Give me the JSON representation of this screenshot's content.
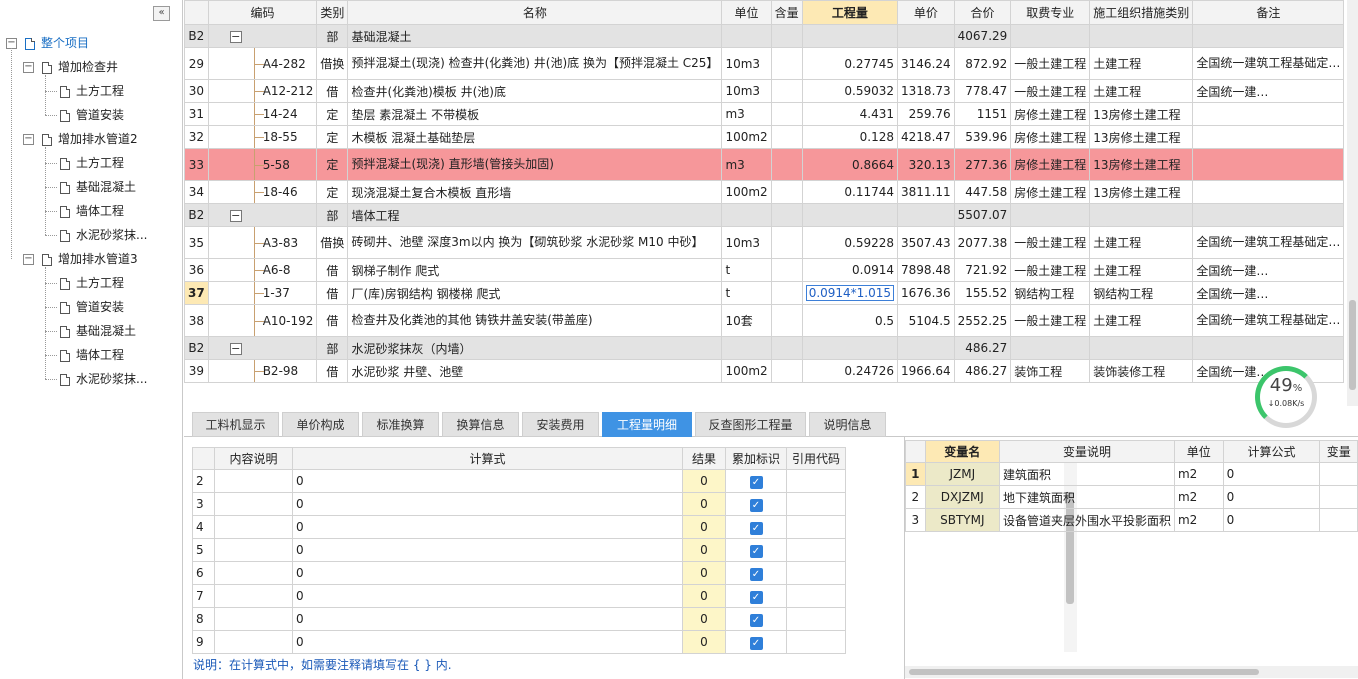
{
  "sidebar": {
    "collapse_icon": "«",
    "root": "整个项目",
    "groups": [
      {
        "label": "增加检查井",
        "children": [
          "土方工程",
          "管道安装"
        ]
      },
      {
        "label": "增加排水管道2",
        "children": [
          "土方工程",
          "基础混凝土",
          "墙体工程",
          "水泥砂浆抹..."
        ]
      },
      {
        "label": "增加排水管道3",
        "children": [
          "土方工程",
          "管道安装",
          "基础混凝土",
          "墙体工程",
          "水泥砂浆抹..."
        ]
      }
    ]
  },
  "grid": {
    "headers": [
      "编码",
      "类别",
      "名称",
      "单位",
      "含量",
      "工程量",
      "单价",
      "合价",
      "取费专业",
      "施工组织措施类别",
      "备注"
    ],
    "rows": [
      {
        "no": "B2",
        "code": "",
        "type": "部",
        "name": "基础混凝土",
        "unit": "",
        "content": "",
        "qty": "",
        "price": "",
        "total": "4067.29",
        "fee": "",
        "measure": "",
        "remark": "",
        "kind": "sec"
      },
      {
        "no": "29",
        "code": "A4-282",
        "type": "借换",
        "name": "预拌混凝土(现浇) 检查井(化粪池) 井(池)底  换为【预拌混凝土 C25】",
        "unit": "10m3",
        "content": "",
        "qty": "0.27745",
        "price": "3146.24",
        "total": "872.92",
        "fee": "一般土建工程",
        "measure": "土建工程",
        "remark": "全国统一建筑工程基础定…",
        "kind": "tall"
      },
      {
        "no": "30",
        "code": "A12-212",
        "type": "借",
        "name": "检查井(化粪池)模板 井(池)底",
        "unit": "10m3",
        "content": "",
        "qty": "0.59032",
        "price": "1318.73",
        "total": "778.47",
        "fee": "一般土建工程",
        "measure": "土建工程",
        "remark": "全国统一建…",
        "kind": ""
      },
      {
        "no": "31",
        "code": "14-24",
        "type": "定",
        "name": "垫层 素混凝土 不带模板",
        "unit": "m3",
        "content": "",
        "qty": "4.431",
        "price": "259.76",
        "total": "1151",
        "fee": "房修土建工程",
        "measure": "13房修土建工程",
        "remark": "",
        "kind": ""
      },
      {
        "no": "32",
        "code": "18-55",
        "type": "定",
        "name": "木模板 混凝土基础垫层",
        "unit": "100m2",
        "content": "",
        "qty": "0.128",
        "price": "4218.47",
        "total": "539.96",
        "fee": "房修土建工程",
        "measure": "13房修土建工程",
        "remark": "",
        "kind": ""
      },
      {
        "no": "33",
        "code": "5-58",
        "type": "定",
        "name": "预拌混凝土(现浇) 直形墙(管接头加固)",
        "unit": "m3",
        "content": "",
        "qty": "0.8664",
        "price": "320.13",
        "total": "277.36",
        "fee": "房修土建工程",
        "measure": "13房修土建工程",
        "remark": "",
        "kind": "hl tall"
      },
      {
        "no": "34",
        "code": "18-46",
        "type": "定",
        "name": "现浇混凝土复合木模板 直形墙",
        "unit": "100m2",
        "content": "",
        "qty": "0.11744",
        "price": "3811.11",
        "total": "447.58",
        "fee": "房修土建工程",
        "measure": "13房修土建工程",
        "remark": "",
        "kind": ""
      },
      {
        "no": "B2",
        "code": "",
        "type": "部",
        "name": "墙体工程",
        "unit": "",
        "content": "",
        "qty": "",
        "price": "",
        "total": "5507.07",
        "fee": "",
        "measure": "",
        "remark": "",
        "kind": "sec"
      },
      {
        "no": "35",
        "code": "A3-83",
        "type": "借换",
        "name": "砖砌井、池壁 深度3m以内  换为【砌筑砂浆 水泥砂浆 M10 中砂】",
        "unit": "10m3",
        "content": "",
        "qty": "0.59228",
        "price": "3507.43",
        "total": "2077.38",
        "fee": "一般土建工程",
        "measure": "土建工程",
        "remark": "全国统一建筑工程基础定…",
        "kind": "tall"
      },
      {
        "no": "36",
        "code": "A6-8",
        "type": "借",
        "name": "钢梯子制作 爬式",
        "unit": "t",
        "content": "",
        "qty": "0.0914",
        "price": "7898.48",
        "total": "721.92",
        "fee": "一般土建工程",
        "measure": "土建工程",
        "remark": "全国统一建…",
        "kind": ""
      },
      {
        "no": "37",
        "code": "1-37",
        "type": "借",
        "name": "厂(库)房钢结构 钢楼梯 爬式",
        "unit": "t",
        "content": "",
        "qty": "0.0914*1.015",
        "price": "1676.36",
        "total": "155.52",
        "fee": "钢结构工程",
        "measure": "钢结构工程",
        "remark": "全国统一建…",
        "kind": "cur"
      },
      {
        "no": "38",
        "code": "A10-192",
        "type": "借",
        "name": "检查井及化粪池的其他 铸铁井盖安装(带盖座)",
        "unit": "10套",
        "content": "",
        "qty": "0.5",
        "price": "5104.5",
        "total": "2552.25",
        "fee": "一般土建工程",
        "measure": "土建工程",
        "remark": "全国统一建筑工程基础定…",
        "kind": "tall"
      },
      {
        "no": "B2",
        "code": "",
        "type": "部",
        "name": "水泥砂浆抹灰（内墙）",
        "unit": "",
        "content": "",
        "qty": "",
        "price": "",
        "total": "486.27",
        "fee": "",
        "measure": "",
        "remark": "",
        "kind": "sec"
      },
      {
        "no": "39",
        "code": "B2-98",
        "type": "借",
        "name": "水泥砂浆 井壁、池壁",
        "unit": "100m2",
        "content": "",
        "qty": "0.24726",
        "price": "1966.64",
        "total": "486.27",
        "fee": "装饰工程",
        "measure": "装饰装修工程",
        "remark": "全国统一建…",
        "kind": ""
      }
    ]
  },
  "gauge": {
    "percent": "49",
    "percent_sign": "%",
    "speed": "↓0.08K/s"
  },
  "tabs": [
    "工料机显示",
    "单价构成",
    "标准换算",
    "换算信息",
    "安装费用",
    "工程量明细",
    "反查图形工程量",
    "说明信息"
  ],
  "active_tab": "工程量明细",
  "detail": {
    "headers": [
      "内容说明",
      "计算式",
      "结果",
      "累加标识",
      "引用代码"
    ],
    "rows": [
      {
        "no": "2",
        "formula": "0",
        "result": "0"
      },
      {
        "no": "3",
        "formula": "0",
        "result": "0"
      },
      {
        "no": "4",
        "formula": "0",
        "result": "0"
      },
      {
        "no": "5",
        "formula": "0",
        "result": "0"
      },
      {
        "no": "6",
        "formula": "0",
        "result": "0"
      },
      {
        "no": "7",
        "formula": "0",
        "result": "0"
      },
      {
        "no": "8",
        "formula": "0",
        "result": "0"
      },
      {
        "no": "9",
        "formula": "0",
        "result": "0"
      }
    ],
    "note": "说明：在计算式中，如需要注释请填写在 { } 内."
  },
  "vars": {
    "headers": [
      "变量名",
      "变量说明",
      "单位",
      "计算公式",
      "变量"
    ],
    "rows": [
      {
        "no": "1",
        "name": "JZMJ",
        "desc": "建筑面积",
        "unit": "m2",
        "formula": "0"
      },
      {
        "no": "2",
        "name": "DXJZMJ",
        "desc": "地下建筑面积",
        "unit": "m2",
        "formula": "0"
      },
      {
        "no": "3",
        "name": "SBTYMJ",
        "desc": "设备管道夹层外围水平投影面积",
        "unit": "m2",
        "formula": "0"
      }
    ]
  },
  "colors": {
    "accent": "#3f93e4",
    "highlight_row": "#f6979a",
    "section_row": "#e3e3e3",
    "selected_header": "#fde9b4"
  }
}
